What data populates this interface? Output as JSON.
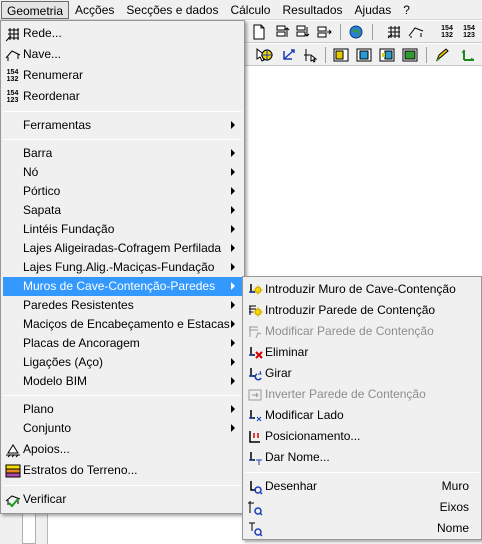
{
  "menubar": {
    "items": [
      "Geometria",
      "Acções",
      "Secções e dados",
      "Cálculo",
      "Resultados",
      "Ajudas",
      "?"
    ]
  },
  "toolbar": {
    "grid_digits_top": "154",
    "grid_digits_bottom": "132",
    "grid_digits_bottom_alt": "123"
  },
  "geometria_menu": {
    "items": [
      {
        "label": "Rede...",
        "icon": "grid-icon"
      },
      {
        "label": "Nave...",
        "icon": "roof-icon"
      },
      {
        "label": "Renumerar",
        "icon": "numbers-154-132-icon"
      },
      {
        "label": "Reordenar",
        "icon": "numbers-154-123-icon"
      },
      {
        "label": "Ferramentas",
        "submenu": true
      },
      {
        "label": "Barra",
        "submenu": true
      },
      {
        "label": "Nó",
        "submenu": true
      },
      {
        "label": "Pórtico",
        "submenu": true
      },
      {
        "label": "Sapata",
        "submenu": true
      },
      {
        "label": "Lintéis Fundação",
        "submenu": true
      },
      {
        "label": "Lajes Aligeiradas-Cofragem Perfilada",
        "submenu": true
      },
      {
        "label": "Lajes Fung.Alig.-Maciças-Fundação",
        "submenu": true
      },
      {
        "label": "Muros de Cave-Contenção-Paredes",
        "submenu": true,
        "highlighted": true
      },
      {
        "label": "Paredes Resistentes",
        "submenu": true
      },
      {
        "label": "Maciços de Encabeçamento e Estacas",
        "submenu": true
      },
      {
        "label": "Placas de Ancoragem",
        "submenu": true
      },
      {
        "label": "Ligações (Aço)",
        "submenu": true
      },
      {
        "label": "Modelo BIM",
        "submenu": true
      },
      {
        "label": "Plano",
        "submenu": true
      },
      {
        "label": "Conjunto",
        "submenu": true
      },
      {
        "label": "Apoios...",
        "icon": "support-icon"
      },
      {
        "label": "Estratos do Terreno...",
        "icon": "soil-strata-icon"
      },
      {
        "label": "Verificar",
        "icon": "verify-icon"
      }
    ]
  },
  "muros_submenu": {
    "items": [
      {
        "label": "Introduzir Muro de Cave-Contenção",
        "icon": "wall-add-icon",
        "enabled": true
      },
      {
        "label": "Introduzir Parede de Contenção",
        "icon": "retaining-wall-add-icon",
        "enabled": true
      },
      {
        "label": "Modificar Parede de Contenção",
        "icon": "retaining-wall-modify-icon",
        "enabled": false
      },
      {
        "label": "Eliminar",
        "icon": "delete-icon",
        "enabled": true
      },
      {
        "label": "Girar",
        "icon": "rotate-icon",
        "enabled": true
      },
      {
        "label": "Inverter Parede de Contenção",
        "icon": "invert-icon",
        "enabled": false
      },
      {
        "label": "Modificar Lado",
        "icon": "modify-side-icon",
        "enabled": true
      },
      {
        "label": "Posicionamento...",
        "icon": "positioning-icon",
        "enabled": true
      },
      {
        "label": "Dar Nome...",
        "icon": "name-icon",
        "enabled": true
      },
      {
        "label": "Desenhar",
        "shortcut": "Muro",
        "icon": "draw-wall-icon",
        "enabled": true
      },
      {
        "label": "",
        "shortcut": "Eixos",
        "icon": "draw-axes-icon",
        "enabled": true
      },
      {
        "label": "",
        "shortcut": "Nome",
        "icon": "draw-name-icon",
        "enabled": true
      }
    ]
  },
  "colors": {
    "highlight": "#3399ff",
    "menu_bg": "#f0f0f0",
    "disabled_text": "#8d8d8d",
    "delete_red": "#d40000"
  }
}
